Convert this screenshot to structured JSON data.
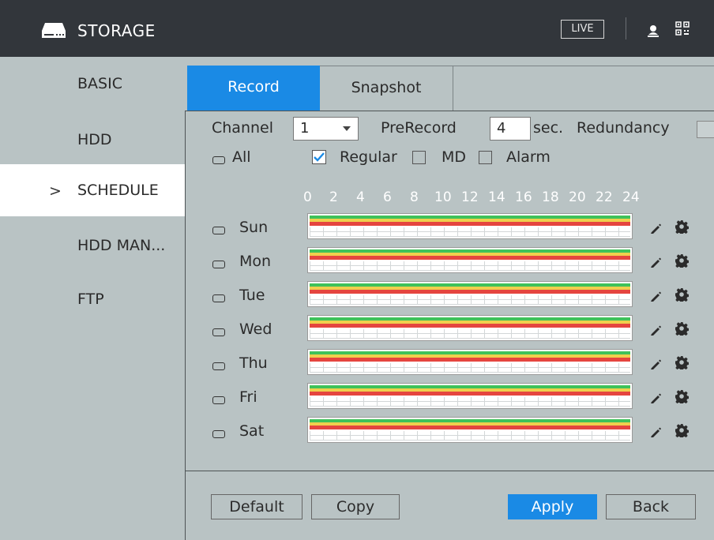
{
  "header": {
    "title": "STORAGE",
    "live_label": "LIVE",
    "icons": [
      "hdd-icon",
      "user-icon",
      "qr-code-icon"
    ]
  },
  "sidebar": {
    "items": [
      {
        "label": "BASIC",
        "active": false
      },
      {
        "label": "HDD",
        "active": false
      },
      {
        "label": "SCHEDULE",
        "active": true
      },
      {
        "label": "HDD MAN...",
        "active": false
      },
      {
        "label": "FTP",
        "active": false
      }
    ],
    "active_marker": ">"
  },
  "tabs": [
    {
      "label": "Record",
      "active": true
    },
    {
      "label": "Snapshot",
      "active": false
    }
  ],
  "settings": {
    "channel_label": "Channel",
    "channel_value": "1",
    "prerecord_label": "PreRecord",
    "prerecord_value": "4",
    "sec_label": "sec.",
    "redundancy_label": "Redundancy",
    "all_label": "All",
    "regular_label": "Regular",
    "regular_checked": true,
    "md_label": "MD",
    "md_checked": false,
    "alarm_label": "Alarm",
    "alarm_checked": false
  },
  "hours": [
    "0",
    "2",
    "4",
    "6",
    "8",
    "10",
    "12",
    "14",
    "16",
    "18",
    "20",
    "22",
    "24"
  ],
  "days": [
    "Sun",
    "Mon",
    "Tue",
    "Wed",
    "Thu",
    "Fri",
    "Sat"
  ],
  "colors": {
    "accent": "#1a8ae5",
    "regular": "#3fc25a",
    "md": "#f0cf4d",
    "alarm": "#e5453f"
  },
  "buttons": {
    "default_label": "Default",
    "copy_label": "Copy",
    "apply_label": "Apply",
    "back_label": "Back"
  }
}
